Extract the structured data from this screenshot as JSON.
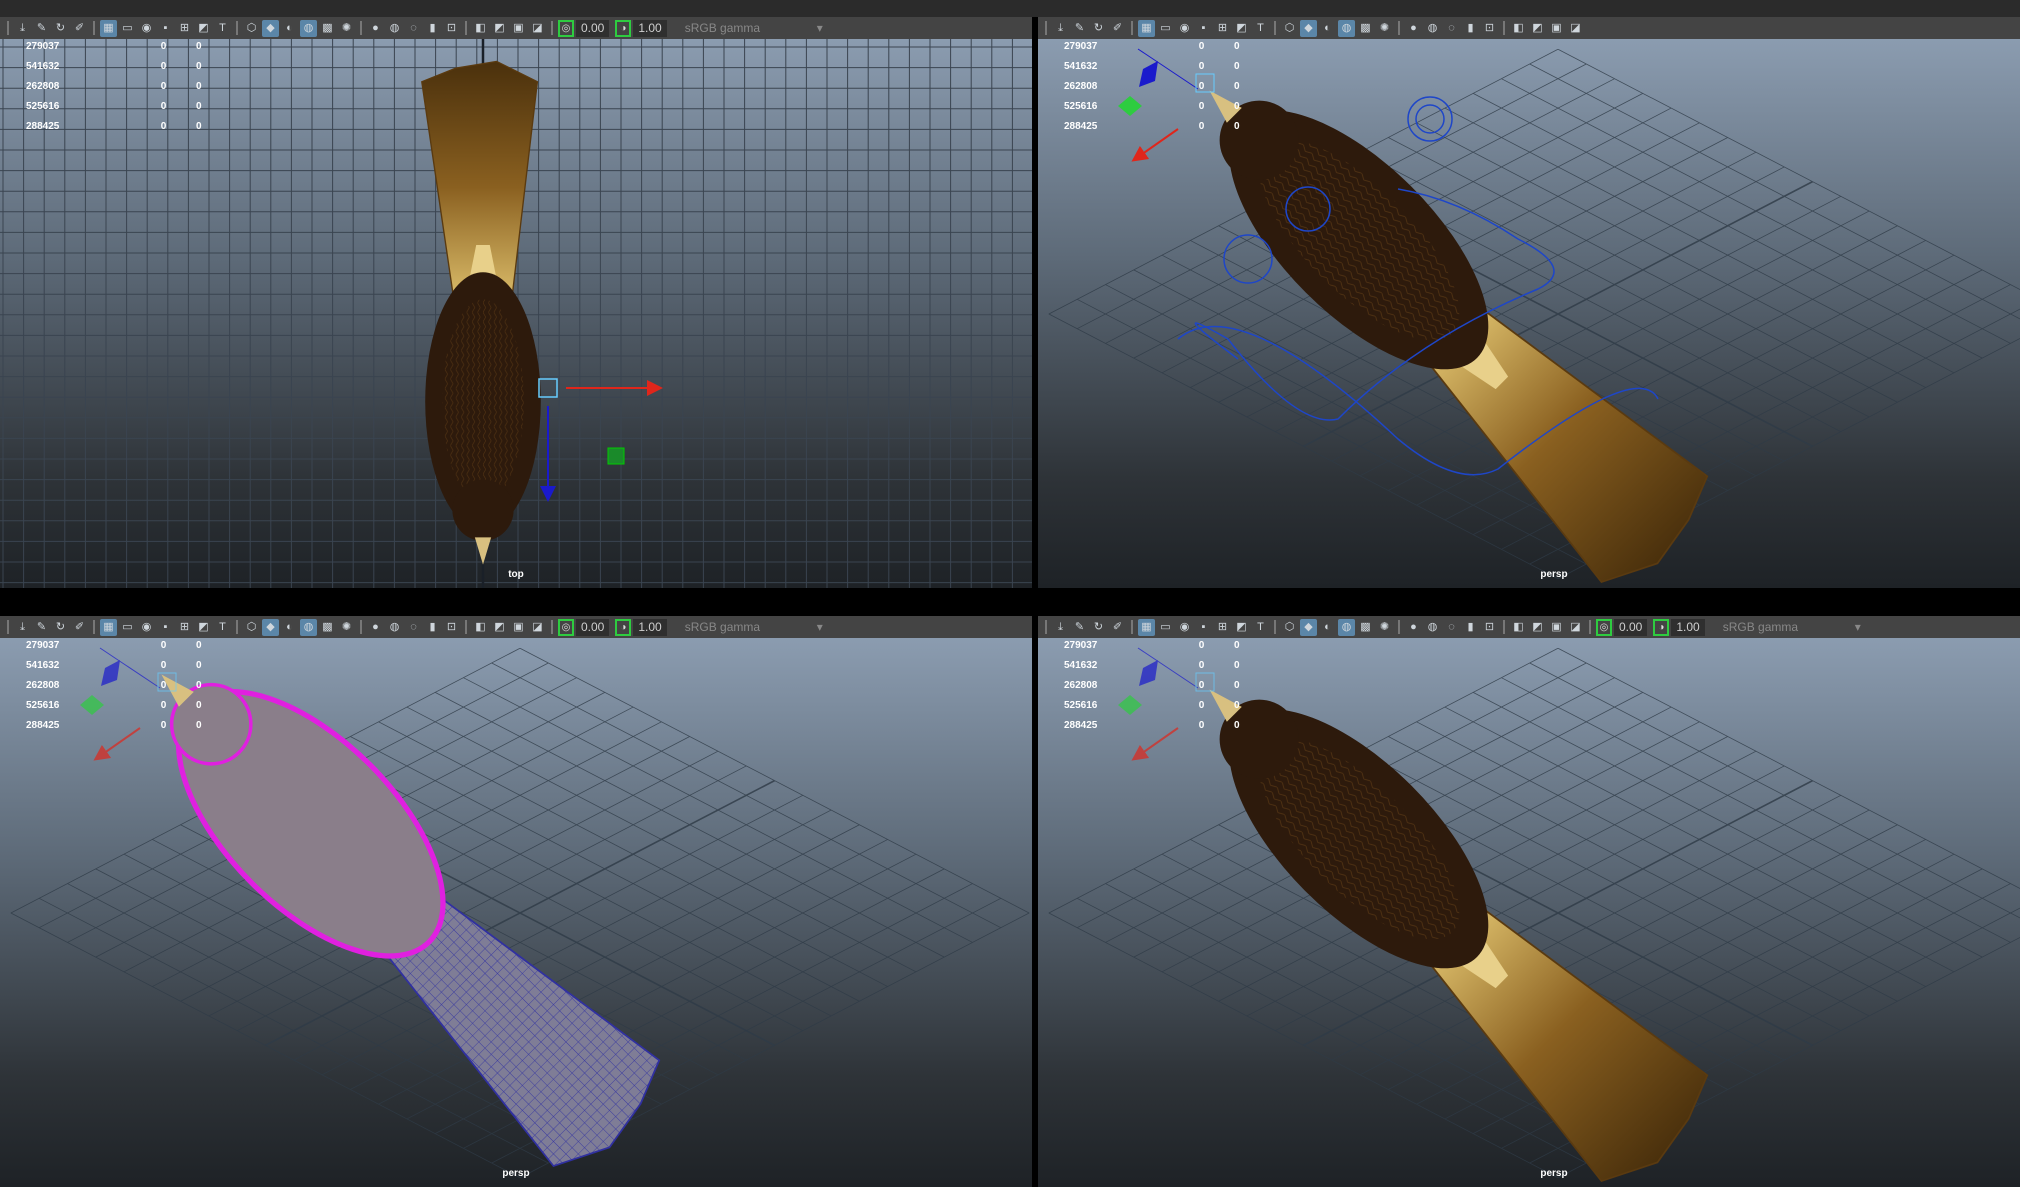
{
  "toolbar": {
    "icons": [
      "select-camera-icon",
      "camera-attributes-icon",
      "bookmark-icon",
      "image-plane-icon",
      "grid-icon",
      "film-gate-icon",
      "resolution-gate-icon",
      "gate-mask-icon",
      "field-chart-icon",
      "safe-action-icon",
      "safe-title-icon",
      "wireframe-icon",
      "smooth-shade-icon",
      "wireframe-on-shaded-icon",
      "xray-icon",
      "texture-icon",
      "lights-icon",
      "shadows-icon",
      "screen-space-ao-icon",
      "motion-blur-icon",
      "anti-alias-icon",
      "depth-of-field-icon",
      "isolate-select-icon",
      "xray-active-icon",
      "xray-joints-icon",
      "xray-components-icon"
    ],
    "exposure": "0.00",
    "gamma": "1.00",
    "colorspace": "sRGB gamma"
  },
  "hud": [
    {
      "label": "279037",
      "a": "0",
      "b": "0"
    },
    {
      "label": "541632",
      "a": "0",
      "b": "0"
    },
    {
      "label": "262808",
      "a": "0",
      "b": "0"
    },
    {
      "label": "525616",
      "a": "0",
      "b": "0"
    },
    {
      "label": "288425",
      "a": "0",
      "b": "0"
    }
  ],
  "panels": [
    {
      "camera": "top",
      "view": "top",
      "color_mgmt": true
    },
    {
      "camera": "persp",
      "view": "persp-rig",
      "color_mgmt": false
    },
    {
      "camera": "persp",
      "view": "persp-wire",
      "color_mgmt": true
    },
    {
      "camera": "persp",
      "view": "persp",
      "color_mgmt": true
    }
  ],
  "colors": {
    "accent": "#5b86a8",
    "x_axis": "#e0261b",
    "y_axis": "#2ecc40",
    "z_axis": "#1a1acc",
    "wire": "#d81ad8"
  }
}
